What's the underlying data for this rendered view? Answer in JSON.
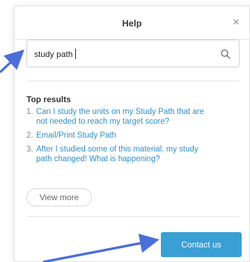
{
  "help_panel": {
    "title": "Help",
    "close_glyph": "×",
    "search": {
      "value": "study path",
      "icon": "search-icon"
    },
    "top_results": {
      "heading": "Top results",
      "items": [
        {
          "number": "1.",
          "line1": "Can I study the units on my Study Path that are",
          "line2": "not needed to reach my target score?"
        },
        {
          "number": "2.",
          "line1": "Email/Print Study Path",
          "line2": ""
        },
        {
          "number": "3.",
          "line1": "After I studied some of this material, my study",
          "line2": "path changed! What is happening?"
        }
      ]
    },
    "view_more_label": "View more",
    "contact_label": "Contact us"
  },
  "colors": {
    "accent": "#3a9fd4",
    "link": "#2f8fc8",
    "annotation_arrow": "#4a6fd8"
  }
}
